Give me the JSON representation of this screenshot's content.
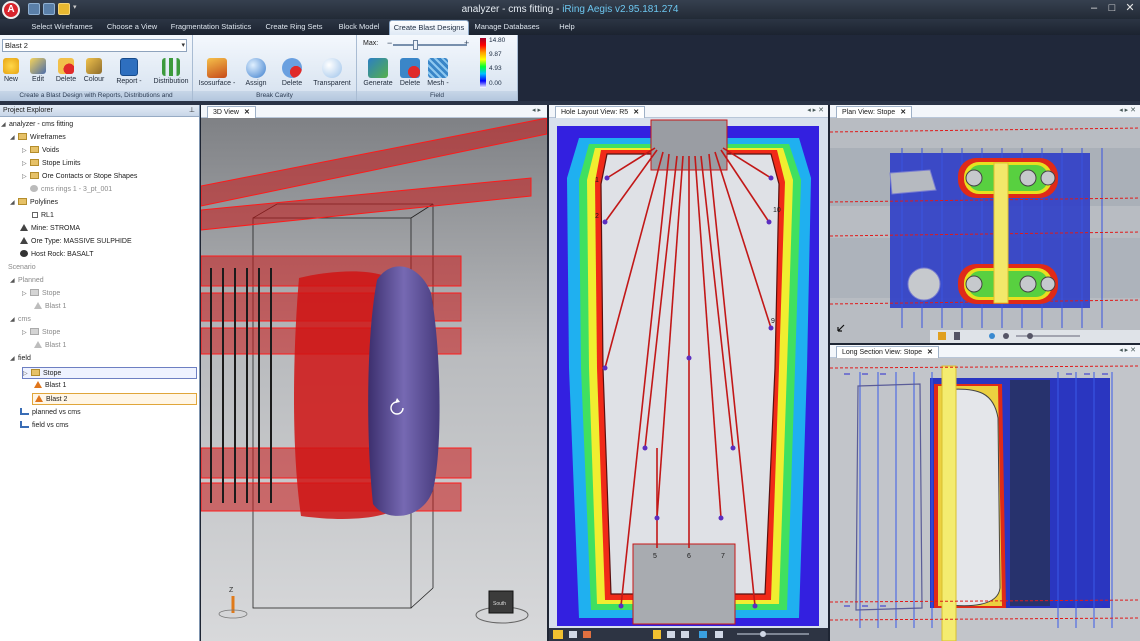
{
  "app": {
    "title": "analyzer - cms fitting",
    "brand_name": "iRing Aegis",
    "version": "v2.95.181.274",
    "logo_letter": "A",
    "window_buttons": [
      "–",
      "□",
      "✕"
    ]
  },
  "ribbon_tabs": [
    {
      "label": "Select Wireframes"
    },
    {
      "label": "Choose a View"
    },
    {
      "label": "Fragmentation Statistics"
    },
    {
      "label": "Create Ring Sets"
    },
    {
      "label": "Block Model"
    },
    {
      "label": "Create Blast Designs",
      "active": true
    },
    {
      "label": "Manage Databases"
    },
    {
      "label": "Help"
    }
  ],
  "ribbon": {
    "blast_select_value": "Blast 2",
    "group1": {
      "buttons": [
        "New",
        "Edit",
        "Delete",
        "Colour",
        "Report -",
        "Distribution"
      ],
      "label": "Create a Blast Design with Reports, Distributions and"
    },
    "group2": {
      "buttons": [
        "Isosurface -",
        "Assign",
        "Delete",
        "Transparent"
      ],
      "label": "Break Cavity"
    },
    "group3": {
      "max_label": "Max:",
      "slider_minus": "−",
      "slider_plus": "+",
      "slider_value": 0.33,
      "buttons": [
        "Generate",
        "Delete",
        "Mesh -"
      ],
      "label": "Field",
      "colorbar_values": [
        "14.80",
        "9.87",
        "4.93",
        "0.00"
      ]
    }
  },
  "explorer": {
    "title": "Project Explorer",
    "pin": "⊥",
    "items": [
      {
        "label": "analyzer - cms fitting"
      },
      {
        "label": "Wireframes"
      },
      {
        "label": "Voids"
      },
      {
        "label": "Stope Limits"
      },
      {
        "label": "Ore Contacts or Stope Shapes"
      },
      {
        "label": "cms rings 1 - 3_pt_001"
      },
      {
        "label": "Polylines"
      },
      {
        "label": "RL1"
      },
      {
        "label": "Mine: STROMA"
      },
      {
        "label": "Ore Type: MASSIVE SULPHIDE"
      },
      {
        "label": "Host Rock: BASALT"
      },
      {
        "label": "Scenario"
      },
      {
        "label": "Planned"
      },
      {
        "label": "Stope"
      },
      {
        "label": "Blast 1"
      },
      {
        "label": "cms"
      },
      {
        "label": "Stope"
      },
      {
        "label": "Blast 1"
      },
      {
        "label": "field"
      },
      {
        "label": "Stope"
      },
      {
        "label": "Blast 1"
      },
      {
        "label": "Blast 2"
      },
      {
        "label": "planned vs cms"
      },
      {
        "label": "field vs cms"
      }
    ]
  },
  "panes": {
    "view3d": {
      "tab": "3D View",
      "nav": "◂ ▸",
      "close": "✕",
      "axis_label": "Z",
      "nav_cube_label": "South"
    },
    "hole_layout": {
      "tab": "Hole Layout View: R5",
      "close": "✕",
      "nav": "◂ ▸ ✕",
      "hole_numbers": [
        "1",
        "2",
        "5",
        "6",
        "7",
        "9",
        "10"
      ]
    },
    "plan": {
      "tab": "Plan View: Stope",
      "close": "✕",
      "nav": "◂ ▸ ✕"
    },
    "long_section": {
      "tab": "Long Section View: Stope",
      "close": "✕",
      "nav": "◂ ▸ ✕"
    }
  },
  "colors": {
    "ribbon_bg": "#dce6f2",
    "titlebar": "#2a3240",
    "accent_red": "#e01a1a",
    "iso_purple": "#6b5fa8"
  }
}
